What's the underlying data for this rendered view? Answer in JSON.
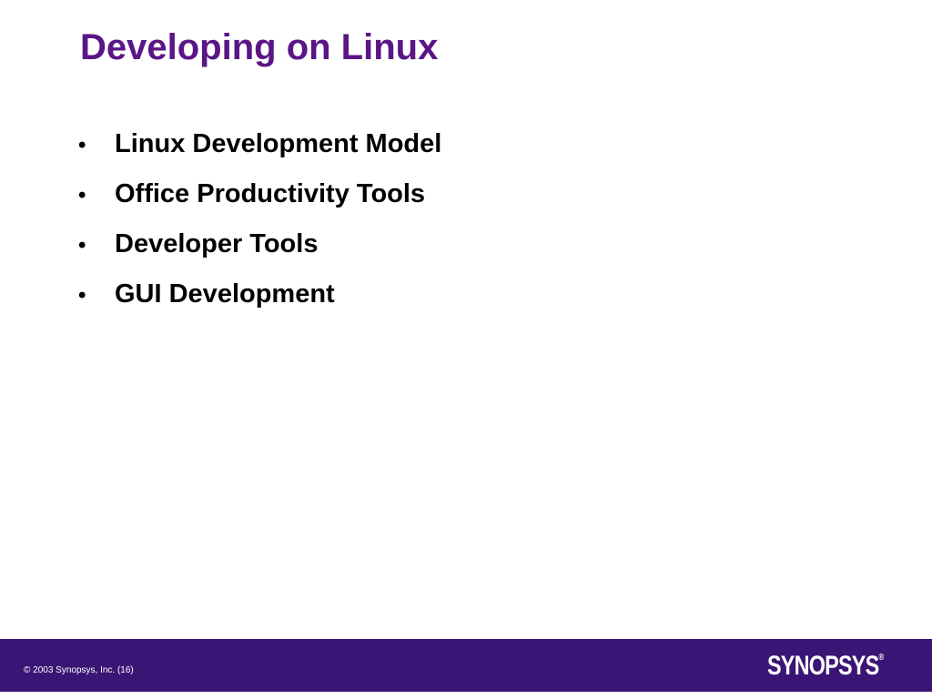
{
  "slide": {
    "title": "Developing on Linux",
    "bullets": [
      "Linux Development Model",
      "Office Productivity Tools",
      "Developer Tools",
      "GUI Development"
    ]
  },
  "footer": {
    "copyright": "© 2003 Synopsys, Inc. (16)",
    "logo_text": "SYNOPSYS",
    "logo_mark": "®"
  },
  "colors": {
    "title": "#5a1586",
    "footer_background": "#3a1575",
    "text": "#000000",
    "footer_text": "#ffffff"
  }
}
